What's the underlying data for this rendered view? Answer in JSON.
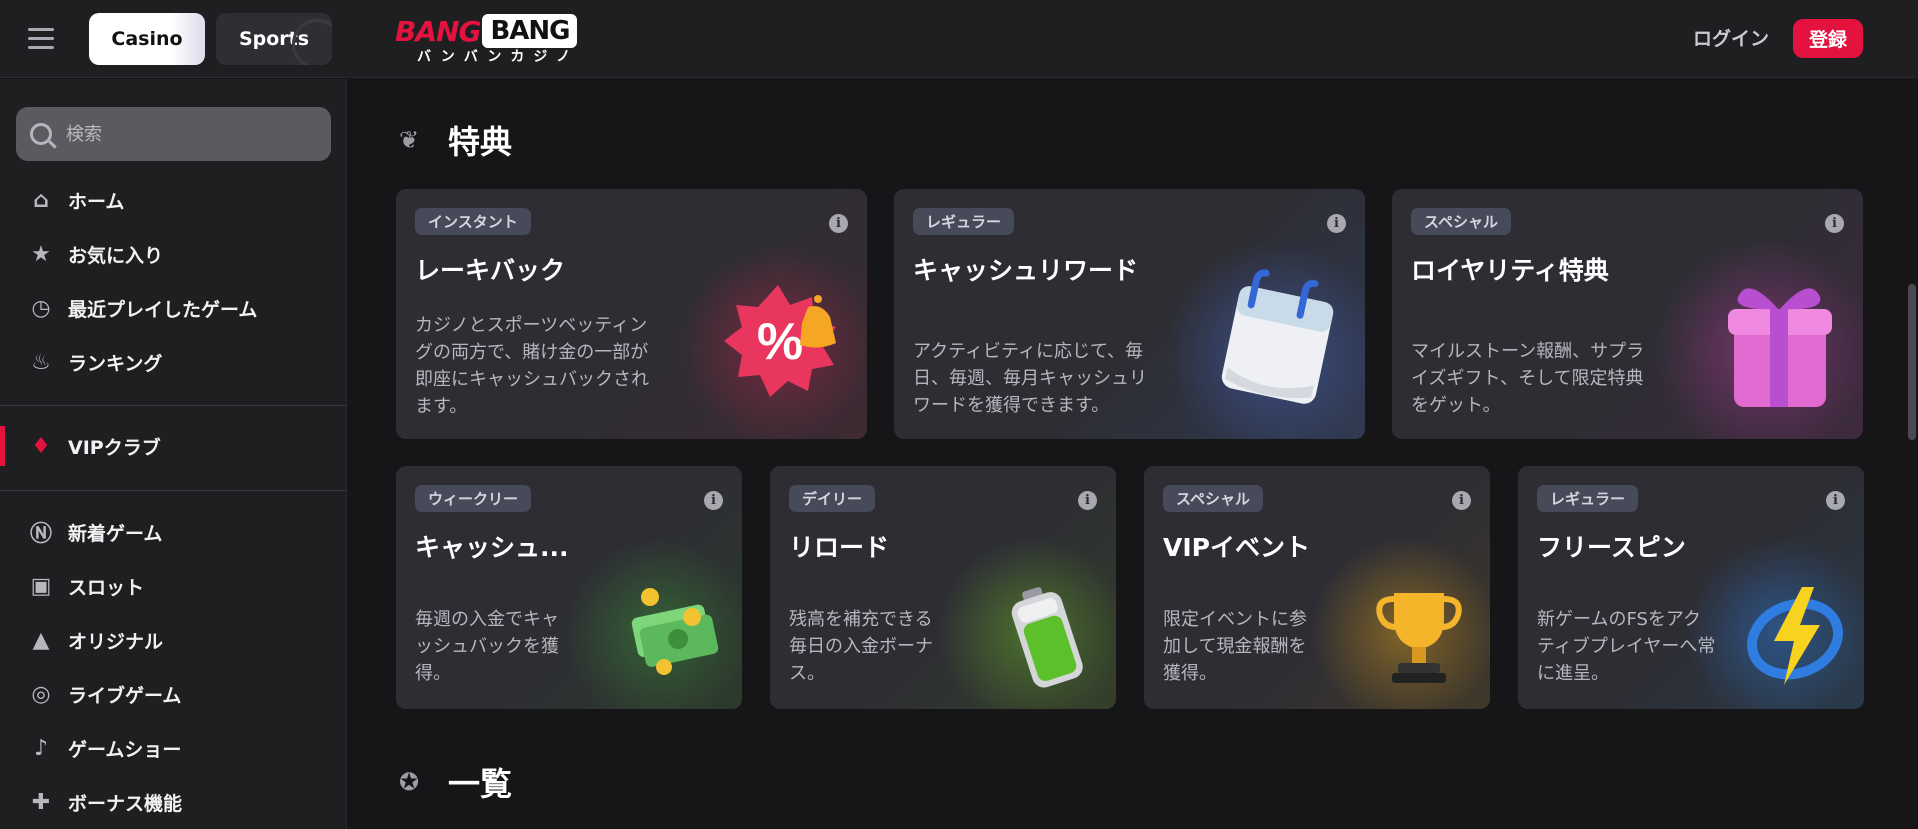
{
  "header": {
    "tabs": [
      {
        "label": "Casino"
      },
      {
        "label": "Sports"
      }
    ],
    "logo_top_left": "BANG",
    "logo_top_right": "BANG",
    "logo_sub": "バンバンカジノ",
    "login_label": "ログイン",
    "register_label": "登録"
  },
  "sidebar": {
    "search_placeholder": "検索",
    "items": [
      {
        "label": "ホーム",
        "icon": "home-icon"
      },
      {
        "label": "お気に入り",
        "icon": "star-icon"
      },
      {
        "label": "最近プレイしたゲーム",
        "icon": "clock-icon"
      },
      {
        "label": "ランキング",
        "icon": "flame-icon"
      },
      {
        "label": "VIPクラブ",
        "icon": "diamond-icon"
      },
      {
        "label": "新着ゲーム",
        "icon": "new-badge-icon"
      },
      {
        "label": "スロット",
        "icon": "slot-machine-icon"
      },
      {
        "label": "オリジナル",
        "icon": "rocket-icon"
      },
      {
        "label": "ライブゲーム",
        "icon": "chip-icon"
      },
      {
        "label": "ゲームショー",
        "icon": "microphone-icon"
      },
      {
        "label": "ボーナス機能",
        "icon": "gift-icon"
      }
    ]
  },
  "main": {
    "section1_title": "特典",
    "section2_title": "一覧",
    "row1": [
      {
        "tag": "インスタント",
        "title": "レーキバック",
        "desc": "カジノとスポーツベッティングの両方で、賭け金の一部が即座にキャッシュバックされます。",
        "art": "percent-badge-bell-icon",
        "accent": "#c8284f"
      },
      {
        "tag": "レギュラー",
        "title": "キャッシュリワード",
        "desc": "アクティビティに応じて、毎日、毎週、毎月キャッシュリワードを獲得できます。",
        "art": "calendar-icon",
        "accent": "#4a6fd8"
      },
      {
        "tag": "スペシャル",
        "title": "ロイヤリティ特典",
        "desc": "マイルストーン報酬、サプライズギフト、そして限定特典をゲット。",
        "art": "gift-box-icon",
        "accent": "#c23fa8"
      }
    ],
    "row2": [
      {
        "tag": "ウィークリー",
        "title": "キャッシュ...",
        "desc": "毎週の入金でキャッシュバックを獲得。",
        "art": "money-stack-icon",
        "accent": "#3f9a3a"
      },
      {
        "tag": "デイリー",
        "title": "リロード",
        "desc": "残高を補充できる毎日の入金ボーナス。",
        "art": "battery-icon",
        "accent": "#6fb92e"
      },
      {
        "tag": "スペシャル",
        "title": "VIPイベント",
        "desc": "限定イベントに参加して現金報酬を獲得。",
        "art": "trophy-icon",
        "accent": "#e0a21f"
      },
      {
        "tag": "レギュラー",
        "title": "フリースピン",
        "desc": "新ゲームのFSをアクティブプレイヤーへ常に進呈。",
        "art": "lightning-icon",
        "accent": "#2f7de0"
      }
    ]
  }
}
